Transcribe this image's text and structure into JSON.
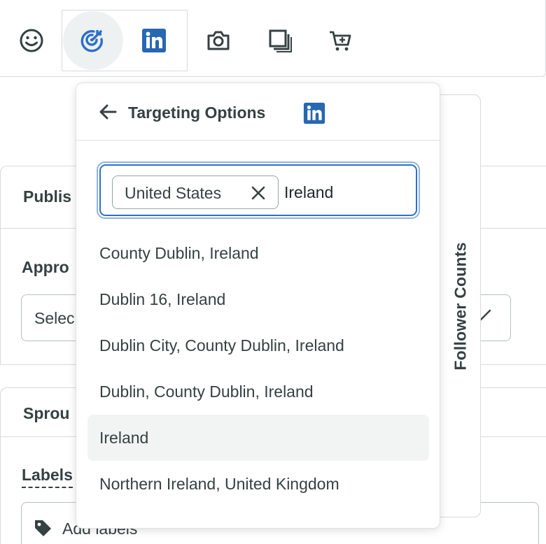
{
  "toolbar": {
    "icons": [
      "smiley-icon",
      "targeting-icon",
      "linkedin-icon",
      "camera-icon",
      "gallery-icon",
      "shop-cart-icon"
    ]
  },
  "background": {
    "publishing_label": "Publis",
    "approval_label": "Appro",
    "select_placeholder": "Selec",
    "sprout_label": "Sprou",
    "labels_heading": "Labels",
    "labels_placeholder": "Add labels"
  },
  "side_tab": {
    "label": "Follower Counts"
  },
  "popover": {
    "title": "Targeting Options",
    "network_icon": "linkedin-icon",
    "selected_token": "United States",
    "query": "Ireland",
    "results": [
      "County Dublin, Ireland",
      "Dublin 16, Ireland",
      "Dublin City, County Dublin, Ireland",
      "Dublin, County Dublin, Ireland",
      "Ireland",
      "Northern Ireland, United Kingdom"
    ],
    "highlighted_result": "Ireland"
  },
  "colors": {
    "linkedin": "#2867b2",
    "accent": "#2d6fc9",
    "text": "#364141",
    "highlight": "#f2f4f4"
  }
}
